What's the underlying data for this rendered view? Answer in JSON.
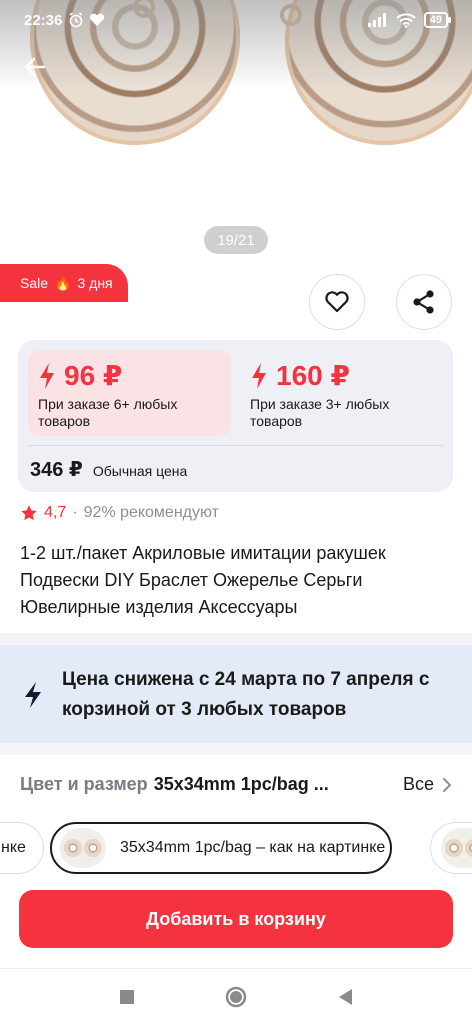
{
  "status_bar": {
    "time": "22:36",
    "battery": "49"
  },
  "gallery": {
    "counter": "19/21"
  },
  "sale_tag": {
    "label": "Sale",
    "emoji": "🔥",
    "duration": "3 дня"
  },
  "prices": {
    "option_1": {
      "price": "96 ₽",
      "note": "При заказе 6+ любых товаров"
    },
    "option_2": {
      "price": "160 ₽",
      "note": "При заказе 3+ любых товаров"
    },
    "regular": {
      "price": "346 ₽",
      "label": "Обычная цена"
    }
  },
  "rating": {
    "score": "4,7",
    "separator": "·",
    "recommend": "92% рекомендуют"
  },
  "product_title": "1-2 шт./пакет Акриловые имитации ракушек Подвески DIY Браслет Ожерелье Серьги Ювелирные изделия Аксессуары",
  "promo": {
    "text": "Цена снижена с 24 марта по 7 апреля с корзиной от 3 любых товаров"
  },
  "variant": {
    "label": "Цвет и размер",
    "value": "35x34mm 1pc/bag ...",
    "all": "Все"
  },
  "chips": {
    "prev": "нке",
    "selected": "35x34mm 1pc/bag – как на картинке"
  },
  "cta": {
    "label": "Добавить в корзину"
  },
  "colors": {
    "accent": "#f5333f",
    "card_bg": "#eef0f6",
    "promo_bg": "#e4ebf8"
  }
}
